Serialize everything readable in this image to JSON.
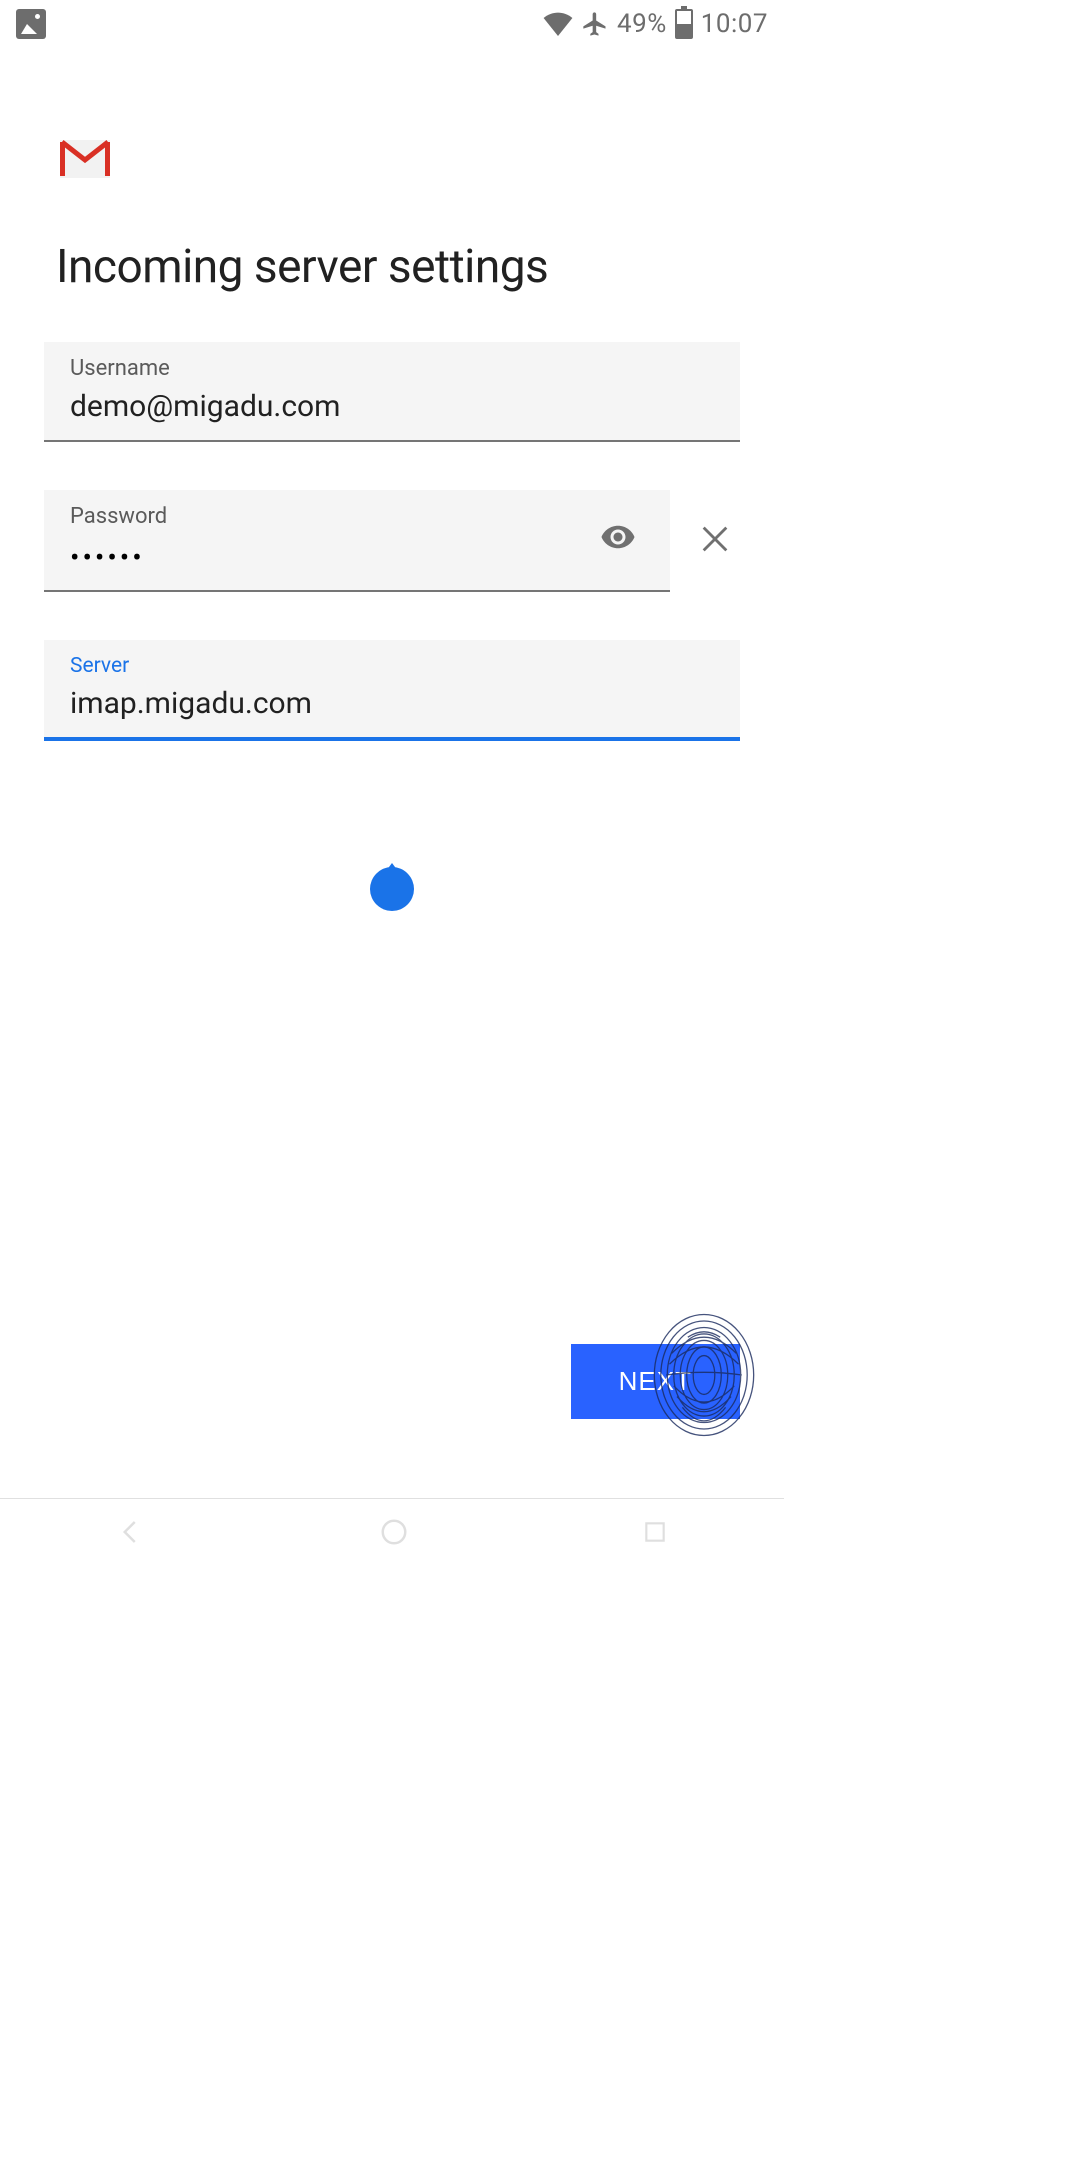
{
  "status": {
    "battery_pct": "49%",
    "time": "10:07"
  },
  "title": "Incoming server settings",
  "fields": {
    "username": {
      "label": "Username",
      "value": "demo@migadu.com"
    },
    "password": {
      "label": "Password",
      "value": "••••••"
    },
    "server": {
      "label": "Server",
      "value": "imap.migadu.com"
    }
  },
  "buttons": {
    "next": "NEXT"
  }
}
